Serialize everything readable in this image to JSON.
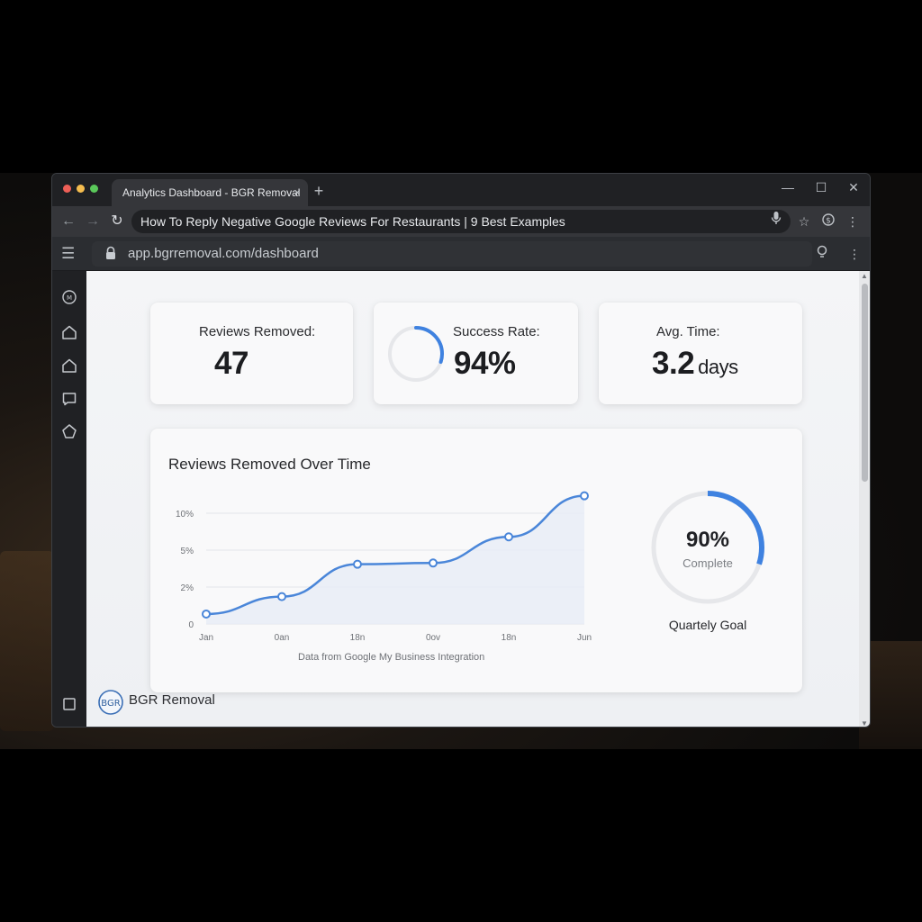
{
  "browser": {
    "tab_title": "Analytics Dashboard - BGR Removal",
    "tab_close": "×",
    "new_tab": "+",
    "window_controls": {
      "minimize": "—",
      "maximize": "☐",
      "close": "✕"
    },
    "nav": {
      "back": "←",
      "forward": "→",
      "reload": "↻"
    },
    "omnibox_text": "How To Reply Negative Google Reviews For Restaurants | 9 Best Examples",
    "icons": [
      "mic-icon",
      "star-icon",
      "extension-icon",
      "kebab-menu-icon"
    ]
  },
  "app": {
    "url": "app.bgrremoval.com/dashboard",
    "sidebar_icons": [
      "logo-icon",
      "home-icon",
      "home-alt-icon",
      "chat-icon",
      "shape-icon",
      "square-icon"
    ]
  },
  "stats": [
    {
      "label": "Reviews Removed:",
      "value": "47",
      "unit": ""
    },
    {
      "label": "Success Rate:",
      "value": "94%",
      "unit": "",
      "ring_fraction": 0.3
    },
    {
      "label": "Avg. Time:",
      "value": "3.2",
      "unit": "days"
    }
  ],
  "chart": {
    "title": "Reviews Removed Over Time",
    "caption": "Data from Google My Business Integration"
  },
  "chart_data": {
    "type": "line",
    "title": "Reviews Removed Over Time",
    "x_tick_labels": [
      "Jan",
      "0an",
      "18n",
      "0ov",
      "18n",
      "Jun"
    ],
    "y_tick_labels": [
      "0",
      "2%",
      "5%",
      "10%"
    ],
    "series": [
      {
        "values": [
          0.8,
          2.2,
          4.8,
          4.9,
          7.0,
          10.3
        ]
      }
    ],
    "ylim": [
      0,
      11
    ],
    "grid": true,
    "area_fill": true,
    "colors": {
      "line": "#4a86d9",
      "fill": "#e7ecf6"
    }
  },
  "goal": {
    "percent_text": "90%",
    "sub_text": "Complete",
    "label": "Quartely Goal",
    "fraction": 0.3,
    "colors": {
      "track": "#e6e7ea",
      "arc": "#3f82e0"
    }
  },
  "brand": {
    "badge": "BGR",
    "name": "BGR Removal"
  },
  "colors": {
    "accent": "#3f82e0",
    "chrome_dark": "#202124",
    "chrome_mid": "#35363a"
  }
}
